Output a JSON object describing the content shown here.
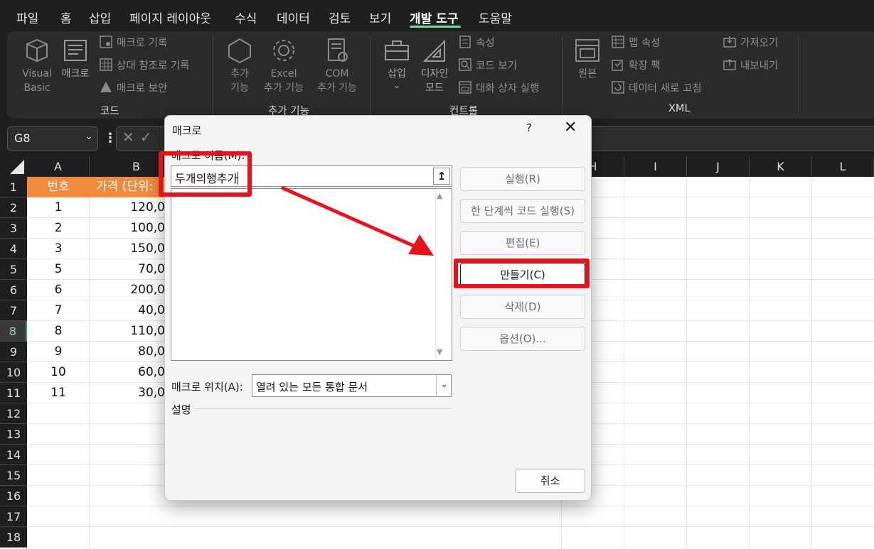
{
  "menu": {
    "tabs": [
      "파일",
      "홈",
      "삽입",
      "페이지 레이아웃",
      "수식",
      "데이터",
      "검토",
      "보기",
      "개발 도구",
      "도움말"
    ],
    "active_tab": "개발 도구"
  },
  "ribbon": {
    "code_group": {
      "label": "코드",
      "visual_basic": "Visual\nBasic",
      "macros": "매크로",
      "record_macro": "매크로 기록",
      "relative_refs": "상대 참조로 기록",
      "macro_security": "매크로 보안"
    },
    "addins_group": {
      "label": "추가 기능",
      "addins": "추가\n기능",
      "excel_addins": "Excel\n추가 기능",
      "com_addins": "COM\n추가 기능"
    },
    "controls_group": {
      "label": "컨트롤",
      "insert": "삽입",
      "design_mode": "디자인\n모드",
      "properties": "속성",
      "view_code": "코드 보기",
      "run_dialog": "대화 상자 실행"
    },
    "xml_group": {
      "label": "XML",
      "source": "원본",
      "map_properties": "맵 속성",
      "expansion_packs": "확장 팩",
      "refresh_data": "데이터 새로 고침",
      "import": "가져오기",
      "export": "내보내기"
    }
  },
  "formula_bar": {
    "name_box": "G8"
  },
  "sheet": {
    "columns": [
      "A",
      "B",
      "H",
      "I",
      "J",
      "K",
      "L"
    ],
    "rows": [
      "1",
      "2",
      "3",
      "4",
      "5",
      "6",
      "7",
      "8",
      "9",
      "10",
      "11",
      "12",
      "13",
      "14",
      "15",
      "16",
      "17",
      "18"
    ],
    "selected_row": "8",
    "header": [
      "번호",
      "가격 (단위:"
    ],
    "data": [
      [
        "1",
        "120,0"
      ],
      [
        "2",
        "100,0"
      ],
      [
        "3",
        "150,0"
      ],
      [
        "5",
        "70,0"
      ],
      [
        "6",
        "200,0"
      ],
      [
        "7",
        "40,0"
      ],
      [
        "8",
        "110,0"
      ],
      [
        "9",
        "80,0"
      ],
      [
        "10",
        "60,0"
      ],
      [
        "11",
        "30,0"
      ]
    ]
  },
  "dialog": {
    "title": "매크로",
    "help": "?",
    "close": "✕",
    "name_label": "매크로 이름(M):",
    "name_value": "두개의행추가",
    "buttons": {
      "run": "실행(R)",
      "step_into": "한 단계씩 코드 실행(S)",
      "edit": "편집(E)",
      "create": "만들기(C)",
      "delete": "삭제(D)",
      "options": "옵션(O)..."
    },
    "location_label": "매크로 위치(A):",
    "location_value": "열려 있는 모든 통합 문서",
    "description_label": "설명",
    "cancel": "취소"
  },
  "colors": {
    "annotation": "#e8121c",
    "header_fill": "#f08a3c",
    "active_tab_underline": "#7fd4a8"
  }
}
